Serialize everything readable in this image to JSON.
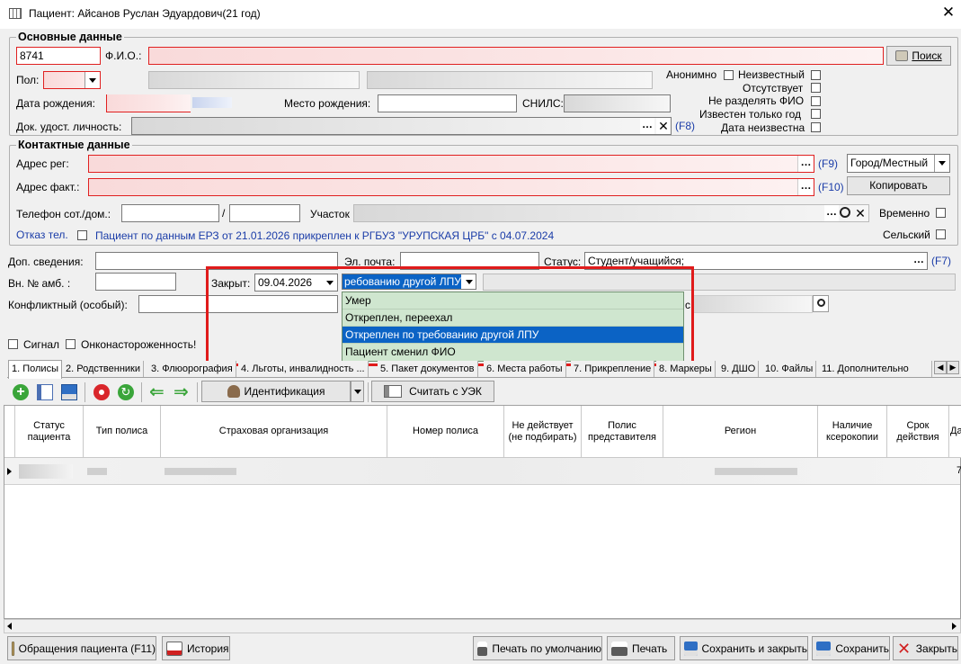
{
  "window": {
    "title": "Пациент: Айсанов Руслан Эдуардович(21 год)"
  },
  "basic": {
    "legend": "Основные данные",
    "id_value": "8741",
    "fio_label": "Ф.И.О.:",
    "search_button": "Поиск",
    "gender_label": "Пол:",
    "anonymous_label": "Анонимно",
    "unknown_label": "Неизвестный",
    "absent_label": "Отсутствует",
    "no_split_fio_label": "Не разделять ФИО",
    "year_only_label": "Известен только год",
    "date_unknown_label": "Дата неизвестна",
    "birth_date_label": "Дата рождения:",
    "birth_place_label": "Место рождения:",
    "snils_label": "СНИЛС:",
    "doc_label": "Док. удост. личность:",
    "doc_hotkey": "(F8)"
  },
  "contact": {
    "legend": "Контактные данные",
    "addr_reg_label": "Адрес рег:",
    "addr_reg_hotkey": "(F9)",
    "locality_value": "Город/Местный",
    "addr_fact_label": "Адрес факт.:",
    "addr_fact_hotkey": "(F10)",
    "copy_button": "Копировать",
    "phone_label": "Телефон сот./дом.:",
    "phone_sep": "/",
    "district_label": "Участок",
    "temporary_label": "Временно",
    "refuse_phone_label": "Отказ тел.",
    "erz_info": "Пациент по данным ЕРЗ от 21.01.2026 прикреплен к РГБУЗ \"УРУПСКАЯ ЦРБ\" с 04.07.2024",
    "rural_label": "Сельский"
  },
  "extra": {
    "add_info_label": "Доп. сведения:",
    "email_label": "Эл. почта:",
    "status_label": "Статус:",
    "status_value": "Студент/учащийся;",
    "status_hotkey": "(F7)",
    "amb_label": "Вн. № амб. :",
    "closed_label": "Закрыт:",
    "closed_date": "09.04.2026",
    "reason_value": "ребованию другой ЛПУ",
    "conflict_label": "Конфликтный (особый):",
    "signal_label": "Сигнал",
    "onco_label": "Онконастороженность!",
    "partial_label": "с"
  },
  "dropdown": {
    "items": [
      "Умер",
      "Откреплен, переехал",
      "Откреплен по требованию другой ЛПУ",
      "Пациент сменил ФИО"
    ],
    "selected_index": 2
  },
  "tabs": [
    "1. Полисы",
    "2. Родственники",
    "3. Флюорография",
    "4. Льготы, инвалидность ...",
    "5. Пакет документов",
    "6. Места работы",
    "7. Прикрепление",
    "8. Маркеры",
    "9. ДШО",
    "10. Файлы",
    "11. Дополнительно"
  ],
  "toolbar": {
    "identify_label": "Идентификация",
    "read_card_label": "Считать с УЭК"
  },
  "grid": {
    "columns": [
      "Статус пациента",
      "Тип полиса",
      "Страховая организация",
      "Номер полиса",
      "Не действует (не подбирать)",
      "Полис представителя",
      "Регион",
      "Наличие ксерокопии",
      "Срок действия",
      "Да"
    ],
    "row_partial_value": "7"
  },
  "footer": {
    "appeals_button": "Обращения пациента (F11)",
    "history_button": "История",
    "print_default_button": "Печать по умолчанию",
    "print_button": "Печать",
    "save_close_button": "Сохранить и закрыть",
    "save_button": "Сохранить",
    "close_button": "Закрыть"
  },
  "colors": {
    "highlight": "#e01b1b",
    "selection": "#0b63c5",
    "link_blue": "#1a3ca8",
    "list_green": "#cfe6cf"
  }
}
